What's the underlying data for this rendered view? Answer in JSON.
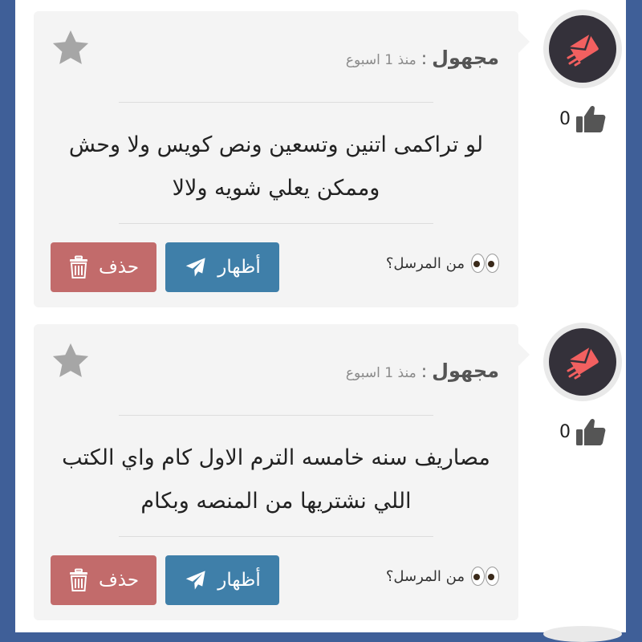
{
  "colors": {
    "page_bg": "#3f5f98",
    "card_bg": "#f4f4f4",
    "show_button": "#3f7fa9",
    "delete_button": "#c26b6b",
    "avatar_bg": "#34313a",
    "avatar_accent": "#f26060"
  },
  "messages": [
    {
      "sender": "مجهول",
      "separator": ":",
      "time": "منذ 1 اسبوع",
      "text": "لو تراكمى اتنين وتسعين ونص كويس ولا وحش وممكن يعلي شويه ولالا",
      "likes": "0",
      "show_label": "أظهار",
      "delete_label": "حذف",
      "who_label": "من المرسل؟",
      "icons": [
        "star-icon",
        "thumbs-up-icon",
        "paper-plane-icon",
        "trash-icon",
        "eyes-icon",
        "envelope-icon"
      ]
    },
    {
      "sender": "مجهول",
      "separator": ":",
      "time": "منذ 1 اسبوع",
      "text": "مصاريف سنه خامسه الترم الاول كام واي الكتب اللي نشتريها من المنصه وبكام",
      "likes": "0",
      "show_label": "أظهار",
      "delete_label": "حذف",
      "who_label": "من المرسل؟",
      "icons": [
        "star-icon",
        "thumbs-up-icon",
        "paper-plane-icon",
        "trash-icon",
        "eyes-icon",
        "envelope-icon"
      ]
    }
  ]
}
